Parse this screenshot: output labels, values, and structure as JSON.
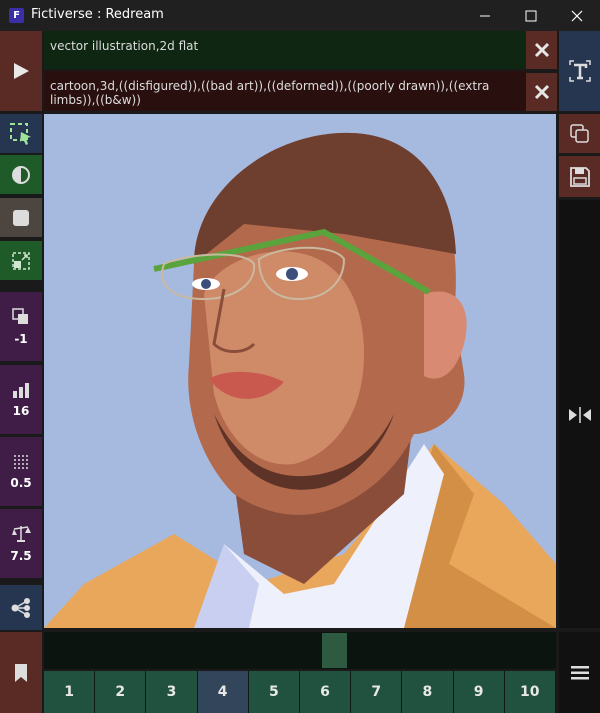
{
  "window": {
    "title": "Fictiverse : Redream"
  },
  "prompts": {
    "positive": "vector illustration,2d flat",
    "negative": "cartoon,3d,((disfigured)),((bad art)),((deformed)),((poorly drawn)),((extra limbs)),((b&w))"
  },
  "left_controls": {
    "batch_value": "-1",
    "steps_value": "16",
    "strength_value": "0.5",
    "guidance_value": "7.5"
  },
  "pages": [
    "1",
    "2",
    "3",
    "4",
    "5",
    "6",
    "7",
    "8",
    "9",
    "10"
  ],
  "active_page": "4",
  "colors": {
    "accent_green": "#1f5b29",
    "accent_purple": "#3f1d47",
    "accent_red": "#5a2a24",
    "accent_navy": "#263650"
  }
}
